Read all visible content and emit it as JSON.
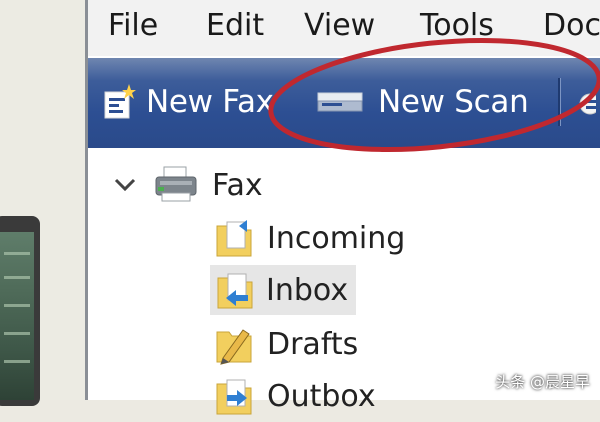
{
  "menu": {
    "file": "File",
    "edit": "Edit",
    "view": "View",
    "tools": "Tools",
    "document": "Doc"
  },
  "toolbar": {
    "new_fax": "New Fax",
    "new_scan": "New Scan"
  },
  "tree": {
    "root": {
      "label": "Fax",
      "icon": "fax-printer-icon",
      "expanded": true
    },
    "folders": [
      {
        "label": "Incoming",
        "icon": "incoming-folder-icon",
        "selected": false
      },
      {
        "label": "Inbox",
        "icon": "inbox-folder-icon",
        "selected": true
      },
      {
        "label": "Drafts",
        "icon": "drafts-folder-icon",
        "selected": false
      },
      {
        "label": "Outbox",
        "icon": "outbox-folder-icon",
        "selected": false
      }
    ]
  },
  "annotation": {
    "color": "#c0282f",
    "target": "New Scan"
  },
  "watermark": "头条 @晨星早",
  "colors": {
    "toolbar_blue": "#2d4f93",
    "folder_yellow": "#f2cf5e",
    "selection_gray": "#e6e6e6"
  }
}
